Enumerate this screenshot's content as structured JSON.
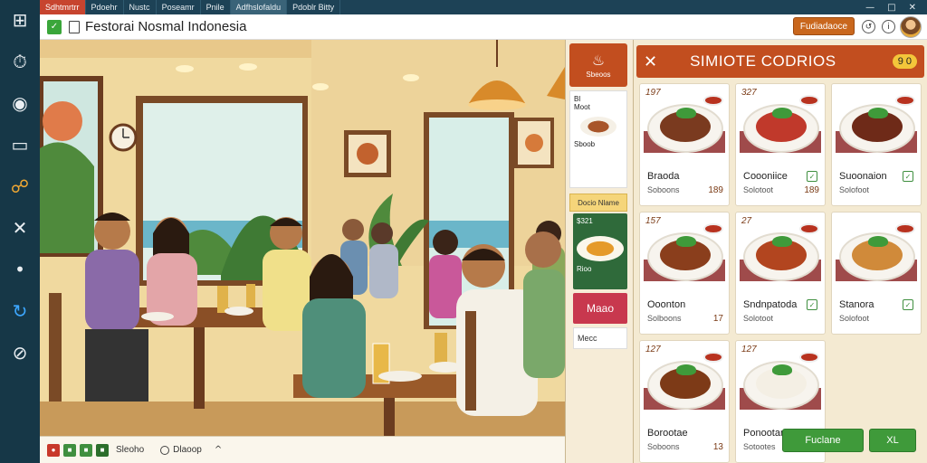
{
  "topbar": {
    "tabs": [
      "Sdhtmrtrr",
      "Pdoehr",
      "Nustc",
      "Poseamr",
      "Pnile",
      "Adfhslofaldu",
      "Pdoblr Bitty"
    ]
  },
  "app": {
    "title": "Festorai Nosmal Indonesia",
    "header_button": "Fudiadaoce"
  },
  "scene_bar": {
    "label": "Sleoho",
    "radio_label": "Dlaoop"
  },
  "side_panel": {
    "head_label": "Sbeoos",
    "card_title": "Bl",
    "card_name": "Moot",
    "card_footer": "Sboob",
    "tag_label": "Docio Nlame",
    "green_price": "$321",
    "green_label": "Rioo",
    "red_label": "Maao",
    "white_label": "Mecc"
  },
  "menu": {
    "title": "SIMIOTE CODRIOS",
    "badge": "9 0",
    "items": [
      {
        "price": "197",
        "name": "Braoda",
        "sub": "Soboons",
        "num": "189",
        "food_color": "#7a3a1f",
        "checked": false
      },
      {
        "price": "327",
        "name": "Coooniice",
        "sub": "Solotoot",
        "num": "189",
        "food_color": "#c0392b",
        "checked": true
      },
      {
        "price": "",
        "name": "Suoonaion",
        "sub": "Solofoot",
        "num": "",
        "food_color": "#6e2a18",
        "checked": true
      },
      {
        "price": "157",
        "name": "Ooonton",
        "sub": "Solboons",
        "num": "17",
        "food_color": "#8a3e1c",
        "checked": false
      },
      {
        "price": "27",
        "name": "Sndnpatoda",
        "sub": "Solotoot",
        "num": "",
        "food_color": "#b2451f",
        "checked": true
      },
      {
        "price": "",
        "name": "Stanora",
        "sub": "Solofoot",
        "num": "",
        "food_color": "#d08a3a",
        "checked": true
      },
      {
        "price": "127",
        "name": "Borootae",
        "sub": "Soboons",
        "num": "13",
        "food_color": "#7d3a17",
        "checked": false
      },
      {
        "price": "127",
        "name": "Ponootars",
        "sub": "Sotootes",
        "num": "",
        "food_color": "#f4efe4",
        "checked": false
      }
    ],
    "buttons": [
      "Fuclane",
      "XL"
    ]
  }
}
